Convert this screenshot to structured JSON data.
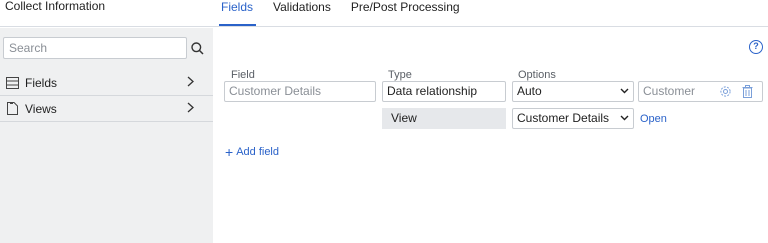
{
  "app": {
    "title": "Collect Information"
  },
  "tabs": [
    {
      "label": "Fields",
      "active": true
    },
    {
      "label": "Validations",
      "active": false
    },
    {
      "label": "Pre/Post Processing",
      "active": false
    }
  ],
  "sidebar": {
    "search_placeholder": "Search",
    "search_icon": "search-icon",
    "items": [
      {
        "label": "Fields",
        "icon": "list-icon"
      },
      {
        "label": "Views",
        "icon": "document-icon"
      }
    ]
  },
  "main": {
    "help_glyph": "?",
    "columns": {
      "field": "Field",
      "type": "Type",
      "options": "Options"
    },
    "row": {
      "field_value": "Customer Details",
      "type_value": "Data relationship",
      "option_value": "Auto",
      "option_target": "Customer"
    },
    "subrow": {
      "type_value": "View",
      "option_value": "Customer Details",
      "link": "Open"
    },
    "add_field": "Add field"
  },
  "colors": {
    "accent": "#2a62c9",
    "sidebar_bg": "#eff0f1",
    "static_cell_bg": "#e6e8eb"
  }
}
